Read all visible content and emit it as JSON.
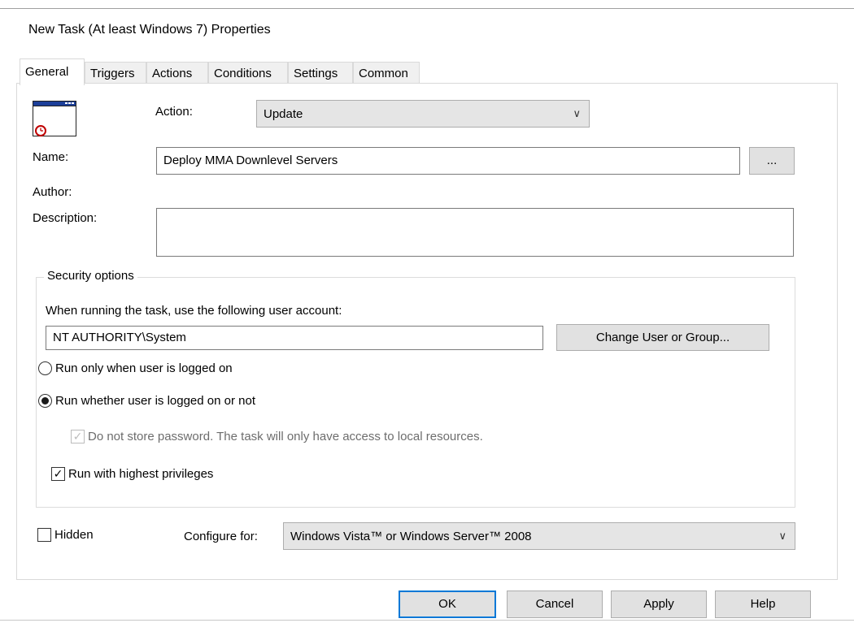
{
  "window": {
    "title": "New Task (At least Windows 7) Properties"
  },
  "tabs": [
    "General",
    "Triggers",
    "Actions",
    "Conditions",
    "Settings",
    "Common"
  ],
  "general": {
    "action_label": "Action:",
    "action_value": "Update",
    "name_label": "Name:",
    "name_value": "Deploy MMA Downlevel Servers",
    "browse_label": "...",
    "author_label": "Author:",
    "description_label": "Description:",
    "description_value": ""
  },
  "security": {
    "title": "Security options",
    "account_prompt": "When running the task, use the following user account:",
    "account_value": "NT AUTHORITY\\System",
    "change_button": "Change User or Group...",
    "radio_logged_on": "Run only when user is logged on",
    "radio_whether": "Run whether user is logged on or not",
    "no_store_password": "Do not store password. The task will only have access to local resources.",
    "highest_privileges": "Run with highest privileges"
  },
  "bottom": {
    "hidden_label": "Hidden",
    "configure_label": "Configure for:",
    "configure_value": "Windows Vista™ or Windows Server™ 2008"
  },
  "buttons": {
    "ok": "OK",
    "cancel": "Cancel",
    "apply": "Apply",
    "help": "Help"
  },
  "icons": [
    "task-window-icon",
    "clock-icon",
    "chevron-down-icon",
    "checkmark-icon"
  ]
}
